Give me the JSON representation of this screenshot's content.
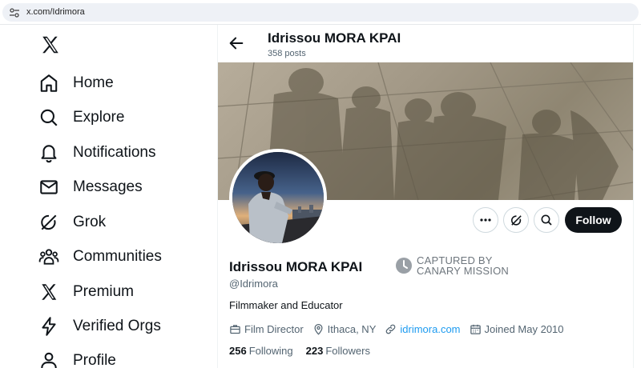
{
  "browser": {
    "url": "x.com/Idrimora"
  },
  "nav": {
    "items": [
      {
        "label": "Home",
        "icon": "home-icon"
      },
      {
        "label": "Explore",
        "icon": "search-icon"
      },
      {
        "label": "Notifications",
        "icon": "bell-icon"
      },
      {
        "label": "Messages",
        "icon": "envelope-icon"
      },
      {
        "label": "Grok",
        "icon": "grok-icon"
      },
      {
        "label": "Communities",
        "icon": "people-icon"
      },
      {
        "label": "Premium",
        "icon": "x-logo-icon"
      },
      {
        "label": "Verified Orgs",
        "icon": "lightning-icon"
      },
      {
        "label": "Profile",
        "icon": "person-icon"
      }
    ]
  },
  "header": {
    "name": "Idrissou MORA KPAI",
    "posts": "358 posts"
  },
  "profile": {
    "name": "Idrissou MORA KPAI",
    "handle": "@Idrimora",
    "badge_line1": "CAPTURED BY",
    "badge_line2": "CANARY MISSION",
    "bio": "Filmmaker and Educator",
    "profession": "Film Director",
    "location": "Ithaca, NY",
    "website": "idrimora.com",
    "joined": "Joined May 2010",
    "following_count": "256",
    "following_label": "Following",
    "followers_count": "223",
    "followers_label": "Followers"
  },
  "actions": {
    "follow_label": "Follow"
  },
  "colors": {
    "accent": "#1d9bf0",
    "text": "#0f1419",
    "muted": "#536471",
    "follow_bg": "#0f1419"
  }
}
